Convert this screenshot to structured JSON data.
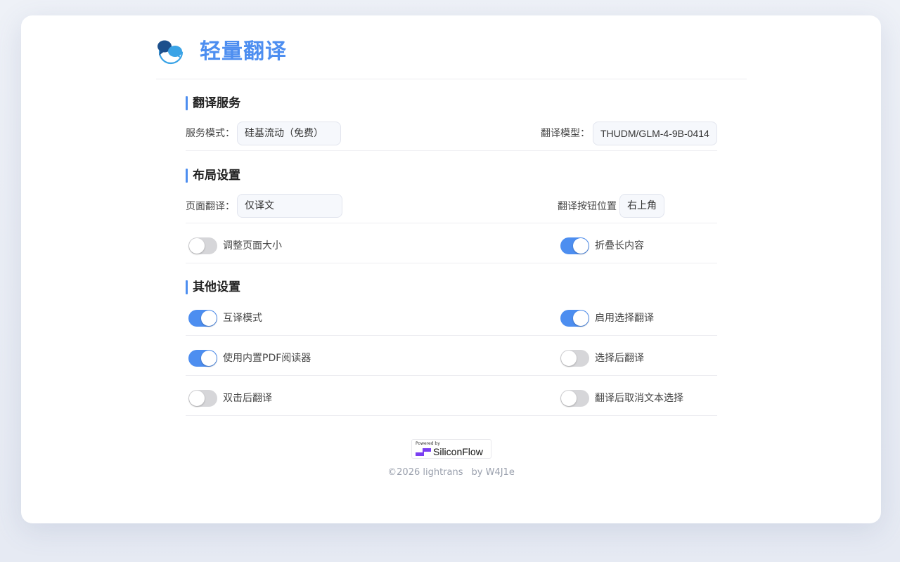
{
  "app": {
    "title": "轻量翻译"
  },
  "sections": {
    "service": {
      "title": "翻译服务",
      "service_mode_label": "服务模式：",
      "service_mode_value": "硅基流动（免费）",
      "model_label": "翻译模型：",
      "model_value": "THUDM/GLM-4-9B-0414"
    },
    "layout": {
      "title": "布局设置",
      "page_translation_label": "页面翻译：",
      "page_translation_value": "仅译文",
      "button_position_label": "翻译按钮位置",
      "button_position_value": "右上角",
      "resize_page": {
        "label": "调整页面大小",
        "on": false
      },
      "collapse_long": {
        "label": "折叠长内容",
        "on": true
      }
    },
    "other": {
      "title": "其他设置",
      "mutual_mode": {
        "label": "互译模式",
        "on": true
      },
      "selection_translate": {
        "label": "启用选择翻译",
        "on": true
      },
      "pdf_reader": {
        "label": "使用内置PDF阅读器",
        "on": true
      },
      "translate_after_select": {
        "label": "选择后翻译",
        "on": false
      },
      "double_click": {
        "label": "双击后翻译",
        "on": false
      },
      "cancel_selection": {
        "label": "翻译后取消文本选择",
        "on": false
      }
    }
  },
  "badge": {
    "small_text": "Powered by",
    "brand": "SiliconFlow"
  },
  "footer": {
    "copyright": "©2026 lightrans",
    "author": "by W4J1e"
  },
  "colors": {
    "accent": "#4d8ef0",
    "toggle_off": "#d6d6d9"
  }
}
